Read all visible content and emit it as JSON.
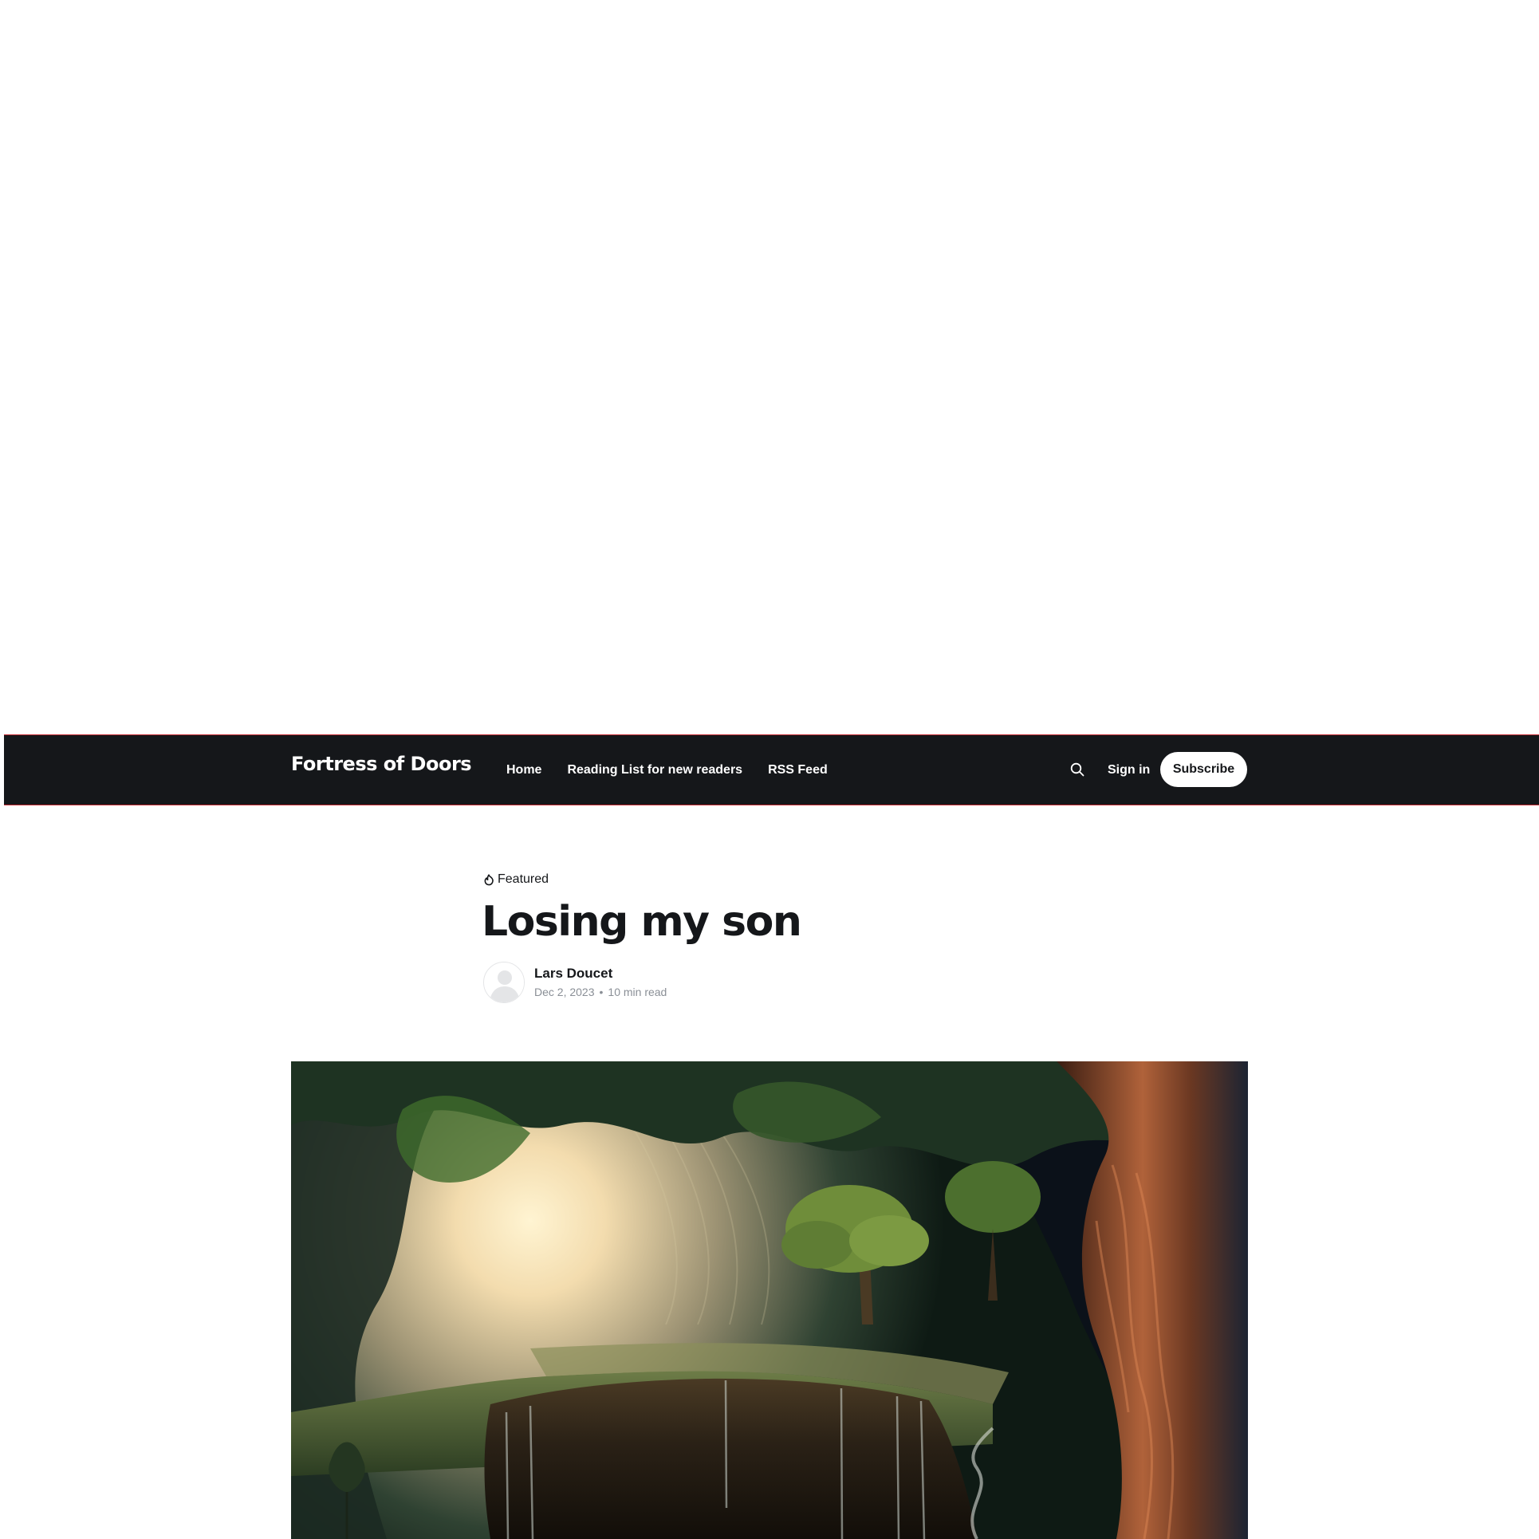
{
  "site": {
    "title": "Fortress of Doors"
  },
  "nav": {
    "items": [
      {
        "label": "Home"
      },
      {
        "label": "Reading List for new readers"
      },
      {
        "label": "RSS Feed"
      }
    ]
  },
  "header_actions": {
    "search_icon": "search-icon",
    "signin_label": "Sign in",
    "subscribe_label": "Subscribe"
  },
  "article": {
    "tag": "Featured",
    "tag_icon": "fire-icon",
    "title": "Losing my son",
    "author": "Lars Doucet",
    "date": "Dec 2, 2023",
    "separator": "•",
    "read_time": "10 min read"
  },
  "colors": {
    "header_bg": "#15171a",
    "header_border": "#c0262d",
    "text": "#15171a",
    "muted": "#8a8f96",
    "button_bg": "#ffffff"
  }
}
